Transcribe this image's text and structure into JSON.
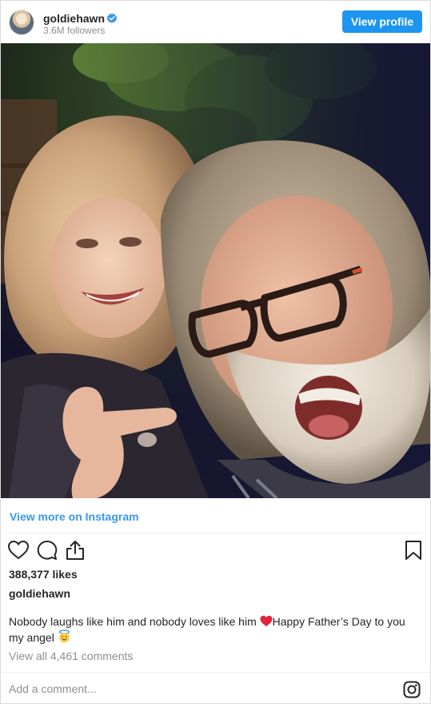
{
  "header": {
    "username": "goldiehawn",
    "followers": "3.6M followers",
    "view_profile_label": "View profile"
  },
  "post": {
    "view_more_label": "View more on Instagram",
    "likes": "388,377 likes",
    "caption_username": "goldiehawn",
    "caption_part1": "Nobody laughs like him and nobody loves like him ",
    "caption_part2": "Happy Father’s Day to you my angel ",
    "view_comments": "View all 4,461 comments"
  },
  "comment": {
    "placeholder": "Add a comment..."
  },
  "icons": {
    "verified": "verified-badge-icon",
    "like": "heart-icon",
    "comment": "comment-bubble-icon",
    "share": "share-icon",
    "save": "bookmark-icon",
    "instagram": "instagram-icon",
    "caption_emoji_1": "red-heart-emoji",
    "caption_emoji_2": "smiling-face-with-halo-emoji"
  },
  "colors": {
    "accent": "#1b95f0",
    "link": "#3897f0",
    "muted": "#8e8e8e",
    "text": "#262626",
    "divider": "#efefef"
  }
}
